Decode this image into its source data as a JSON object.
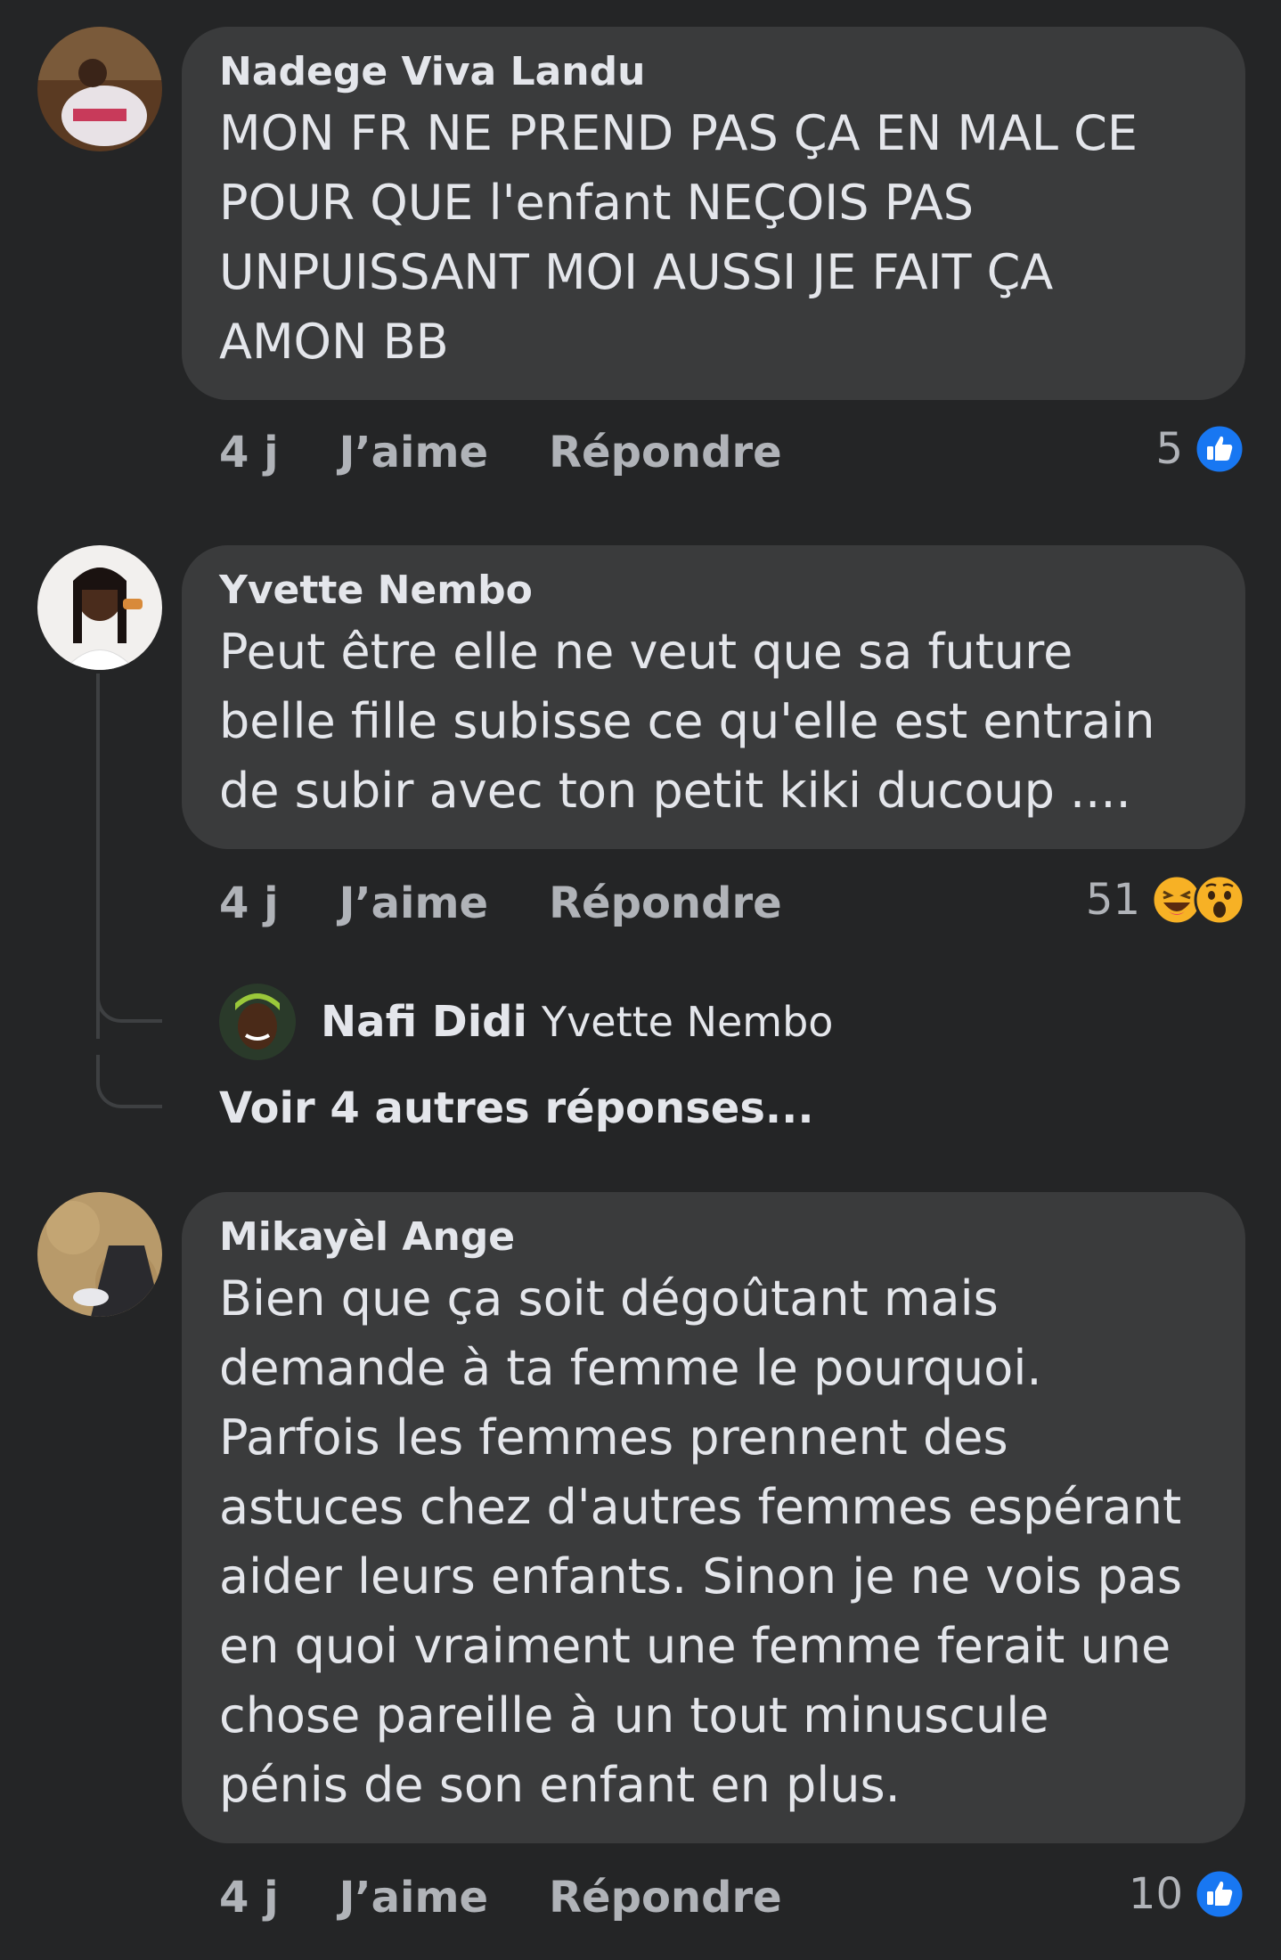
{
  "comments": [
    {
      "author": "Nadege Viva Landu",
      "text": "MON FR NE PREND PAS ÇA EN MAL CE\nPOUR QUE l'enfant NEÇOIS PAS\nUNPUISSANT MOI AUSSI JE FAIT ÇA\nAMON BB",
      "time": "4 j",
      "like_label": "J’aime",
      "reply_label": "Répondre",
      "reaction_count": "5",
      "reactions": [
        "like-icon"
      ]
    },
    {
      "author": "Yvette Nembo",
      "text": "Peut être elle ne veut que sa future\nbelle fille subisse ce qu'elle est entrain\nde subir avec ton petit kiki ducoup ....",
      "time": "4 j",
      "like_label": "J’aime",
      "reply_label": "Répondre",
      "reaction_count": "51",
      "reactions": [
        "haha-icon",
        "wow-icon"
      ],
      "reply_preview": {
        "author": "Nafi Didi",
        "mention": "Yvette Nembo"
      },
      "more_replies": "Voir 4 autres réponses..."
    },
    {
      "author": "Mikayèl Ange",
      "text": "Bien que ça soit dégoûtant mais\ndemande à ta femme le pourquoi.\nParfois les femmes prennent des\nastuces chez d'autres femmes espérant\naider leurs enfants. Sinon je ne vois pas\nen quoi vraiment une femme ferait une\nchose pareille à un tout minuscule\npénis de son enfant en plus.",
      "time": "4 j",
      "like_label": "J’aime",
      "reply_label": "Répondre",
      "reaction_count": "10",
      "reactions": [
        "like-icon"
      ]
    }
  ],
  "colors": {
    "background": "#242526",
    "bubble": "#3a3b3c",
    "text_primary": "#e4e6eb",
    "text_secondary": "#b0b3b8",
    "like_blue": "#1877f2",
    "haha_yellow": "#f7b125"
  }
}
